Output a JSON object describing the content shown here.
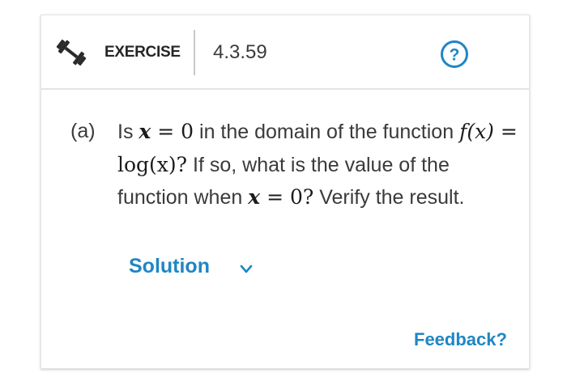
{
  "header": {
    "exercise_label": "EXERCISE",
    "exercise_number": "4.3.59",
    "help_icon": "question-circle-icon",
    "exercise_icon": "dumbbell-icon"
  },
  "problem": {
    "part_label": "(a)",
    "t1": "Is ",
    "m_x1": "x",
    "m_eq1": " = ",
    "m_zero1": "0",
    "t2": " in the domain of the function ",
    "m_f": "f",
    "m_paren_x": "(x)",
    "m_eq2": " = ",
    "m_log": "log(x)?",
    "t3": " If so, what is the value of the function when ",
    "m_x2": "x",
    "m_eq3": " = ",
    "m_zero2": "0?",
    "t4": " Verify the result."
  },
  "solution": {
    "label": "Solution",
    "icon": "chevron-down-icon"
  },
  "footer": {
    "feedback_label": "Feedback?"
  },
  "colors": {
    "accent": "#1f86c4",
    "text": "#3a3a3a",
    "divider": "#e3e3e3"
  }
}
